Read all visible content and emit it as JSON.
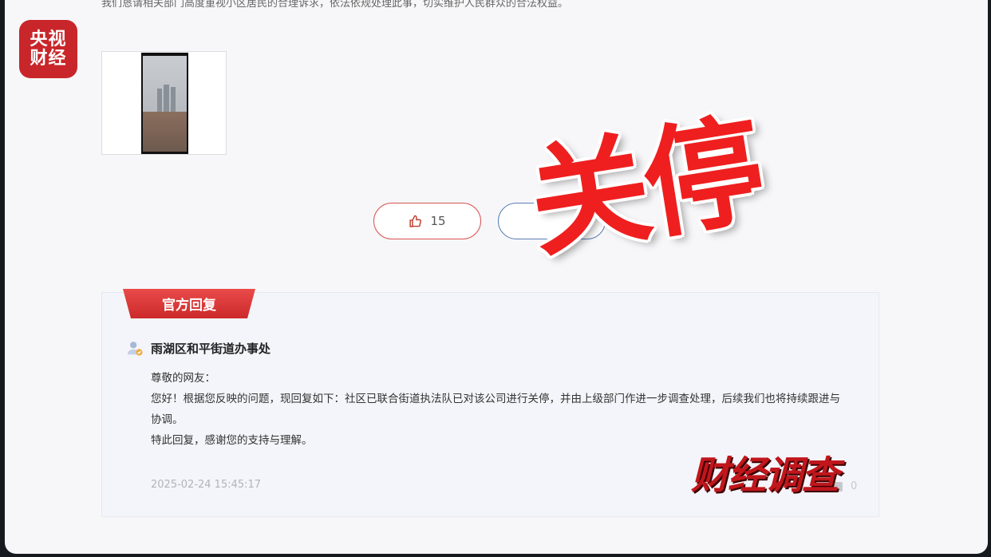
{
  "article": {
    "top_text": "我们恳请相关部门高度重视小区居民的合理诉求，依法依规处理此事，切实维护人民群众的合法权益。"
  },
  "actions": {
    "like_count": "15"
  },
  "reply": {
    "tag_label": "官方回复",
    "org_name": "雨湖区和平街道办事处",
    "greeting": "尊敬的网友：",
    "body_line1": "您好！根据您反映的问题，现回复如下：社区已联合街道执法队已对该公司进行关停，并由上级部门作进一步调查处理，后续我们也将持续跟进与协调。",
    "closing": "特此回复，感谢您的支持与理解。",
    "timestamp": "2025-02-24 15:45:17",
    "corner_count": "0"
  },
  "overlay": {
    "logo_line1": "央视",
    "logo_line2": "财经",
    "big_text": "关停",
    "brand_text": "财经调查"
  },
  "colors": {
    "accent_red": "#d9534f",
    "tag_red": "#cc2a2a",
    "panel_bg": "#f4f5fa"
  }
}
